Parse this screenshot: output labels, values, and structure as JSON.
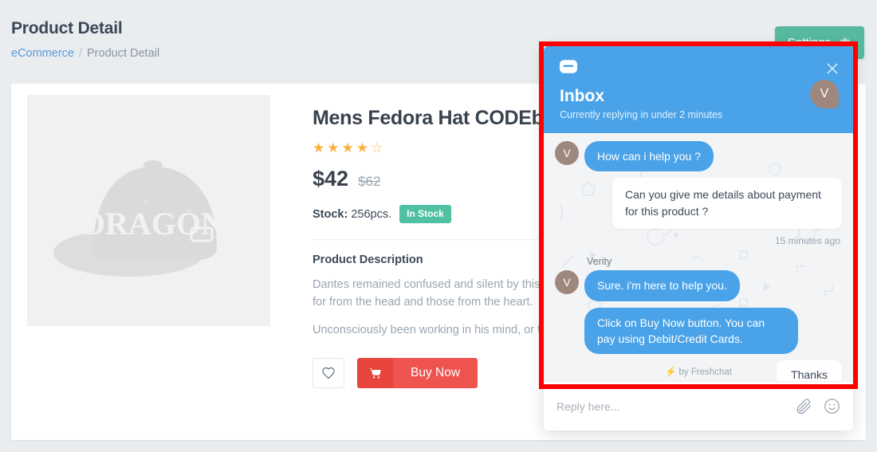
{
  "page": {
    "title": "Product Detail",
    "breadcrumb": {
      "root": "eCommerce",
      "separator": "/",
      "current": "Product Detail"
    },
    "settings_button": "Settings"
  },
  "product": {
    "title": "Mens Fedora Hat CODEblack",
    "rating": 4,
    "rating_max": 5,
    "price": "$42",
    "price_old": "$62",
    "stock_label": "Stock:",
    "stock_value": "256pcs.",
    "stock_badge": "In Stock",
    "description_heading": "Product Description",
    "description_p1": "Dantes remained confused and silent by this, been working in his mind, or rather soul; for from the head and those from the heart.",
    "description_p2": "Unconsciously been working in his mind, or that proceed from the head and those from",
    "image_alt_text": "DRAGON",
    "wishlist_label": "heart-outline",
    "buy_button": "Buy Now"
  },
  "chat": {
    "title": "Inbox",
    "subtitle": "Currently replying in under 2 minutes",
    "close_label": "×",
    "avatar_initial": "V",
    "agent_name": "Verity",
    "messages": [
      {
        "from": "agent",
        "text": "How can i help you ?"
      },
      {
        "from": "user",
        "text": "Can you give me details about payment for this product ?"
      },
      {
        "from": "agent",
        "text": "Sure. i'm here to help you."
      },
      {
        "from": "agent",
        "text": "Click on Buy Now button. You can pay using Debit/Credit Cards."
      },
      {
        "from": "user",
        "text": "Thanks"
      }
    ],
    "timestamp": "15 minutes ago",
    "branding": "by Freshchat",
    "input_placeholder": "Reply here...",
    "attach_icon": "paperclip-icon",
    "emoji_icon": "smiley-icon"
  },
  "colors": {
    "chat_blue": "#4aa3e8",
    "settings_green": "#56b9a0",
    "stock_green": "#4fc0a1",
    "buy_red": "#ef5350",
    "star_amber": "#fbb03b",
    "highlight_red": "#fe0000",
    "avatar_brown": "#9e877d"
  }
}
